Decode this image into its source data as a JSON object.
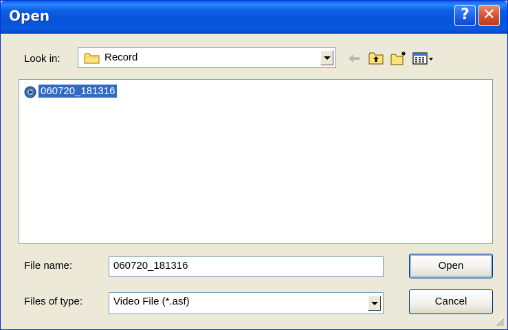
{
  "window": {
    "title": "Open"
  },
  "titlebar": {
    "help_label": "?",
    "close_label": "✕"
  },
  "lookin": {
    "label": "Look in:",
    "value": "Record"
  },
  "toolbar": {
    "back": "back-arrow-icon",
    "up": "up-one-level-icon",
    "new_folder": "create-new-folder-icon",
    "views": "view-menu-icon"
  },
  "files": [
    {
      "name": "060720_181316",
      "icon": "video-file-icon",
      "selected": true
    }
  ],
  "filename": {
    "label": "File name:",
    "value": "060720_181316"
  },
  "filetype": {
    "label": "Files of type:",
    "value": "Video File (*.asf)"
  },
  "buttons": {
    "open": "Open",
    "cancel": "Cancel"
  },
  "colors": {
    "titlebar": "#0553d8",
    "selection": "#316ac5",
    "face": "#ece9d8",
    "border": "#7f9db9"
  }
}
